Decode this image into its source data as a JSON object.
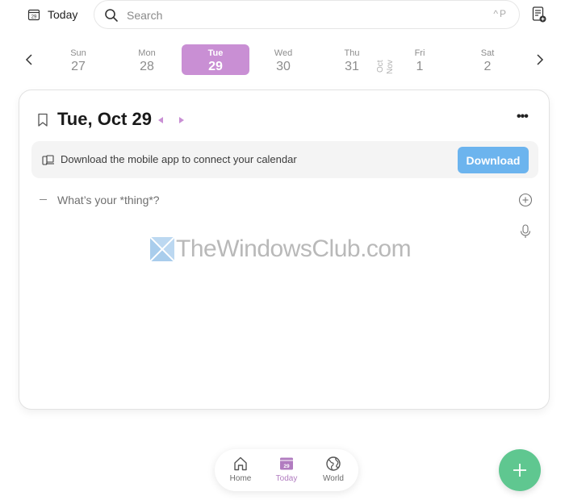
{
  "topbar": {
    "today_label": "Today",
    "calendar_icon_day": "29",
    "search_placeholder": "Search",
    "search_value": "",
    "search_shortcut": "^P"
  },
  "week": {
    "days": [
      {
        "name": "Sun",
        "date": "27",
        "selected": false
      },
      {
        "name": "Mon",
        "date": "28",
        "selected": false
      },
      {
        "name": "Tue",
        "date": "29",
        "selected": true
      },
      {
        "name": "Wed",
        "date": "30",
        "selected": false
      },
      {
        "name": "Thu",
        "date": "31",
        "selected": false
      },
      {
        "name": "Fri",
        "date": "1",
        "selected": false
      },
      {
        "name": "Sat",
        "date": "2",
        "selected": false
      }
    ],
    "month_divider": {
      "prev": "Oct",
      "next": "Nov"
    }
  },
  "card": {
    "title": "Tue, Oct 29",
    "more_label": "•••",
    "banner": {
      "message": "Download the mobile app to connect your calendar",
      "button_label": "Download"
    },
    "thing_placeholder": "What’s your *thing*?",
    "thing_value": ""
  },
  "watermark": {
    "text": "TheWindowsClub.com"
  },
  "bottom_nav": {
    "items": [
      {
        "label": "Home",
        "icon": "home-icon",
        "active": false
      },
      {
        "label": "Today",
        "icon": "calendar-icon",
        "active": true,
        "icon_day": "29"
      },
      {
        "label": "World",
        "icon": "globe-icon",
        "active": false
      }
    ]
  },
  "fab": {
    "icon": "plus-icon"
  },
  "colors": {
    "accent_purple": "#c98fd4",
    "download_blue": "#6cb4ee",
    "fab_green": "#5fc790",
    "banner_bg": "#f4f4f4"
  }
}
